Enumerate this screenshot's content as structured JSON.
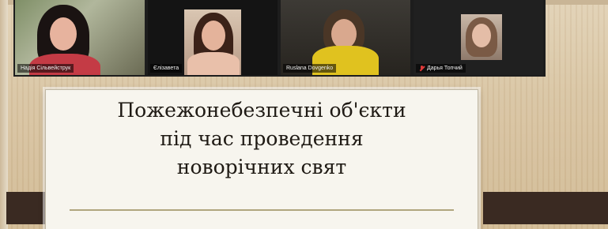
{
  "participants": [
    {
      "name": "Надія Сільвейструк",
      "muted": false,
      "active": false
    },
    {
      "name": "Єлізавета",
      "muted": false,
      "active": false
    },
    {
      "name": "Ruslana Dovgenko",
      "muted": false,
      "active": true
    },
    {
      "name": "Дарья Топчий",
      "muted": true,
      "active": false
    }
  ],
  "slide": {
    "title_lines": [
      "Пожежонебезпечні об'єкти",
      "під час проведення",
      "новорічних свят"
    ]
  },
  "colors": {
    "active_speaker_border": "#b7ff00",
    "muted_icon": "#e13a3a",
    "slide_rule": "#b0a67e"
  }
}
